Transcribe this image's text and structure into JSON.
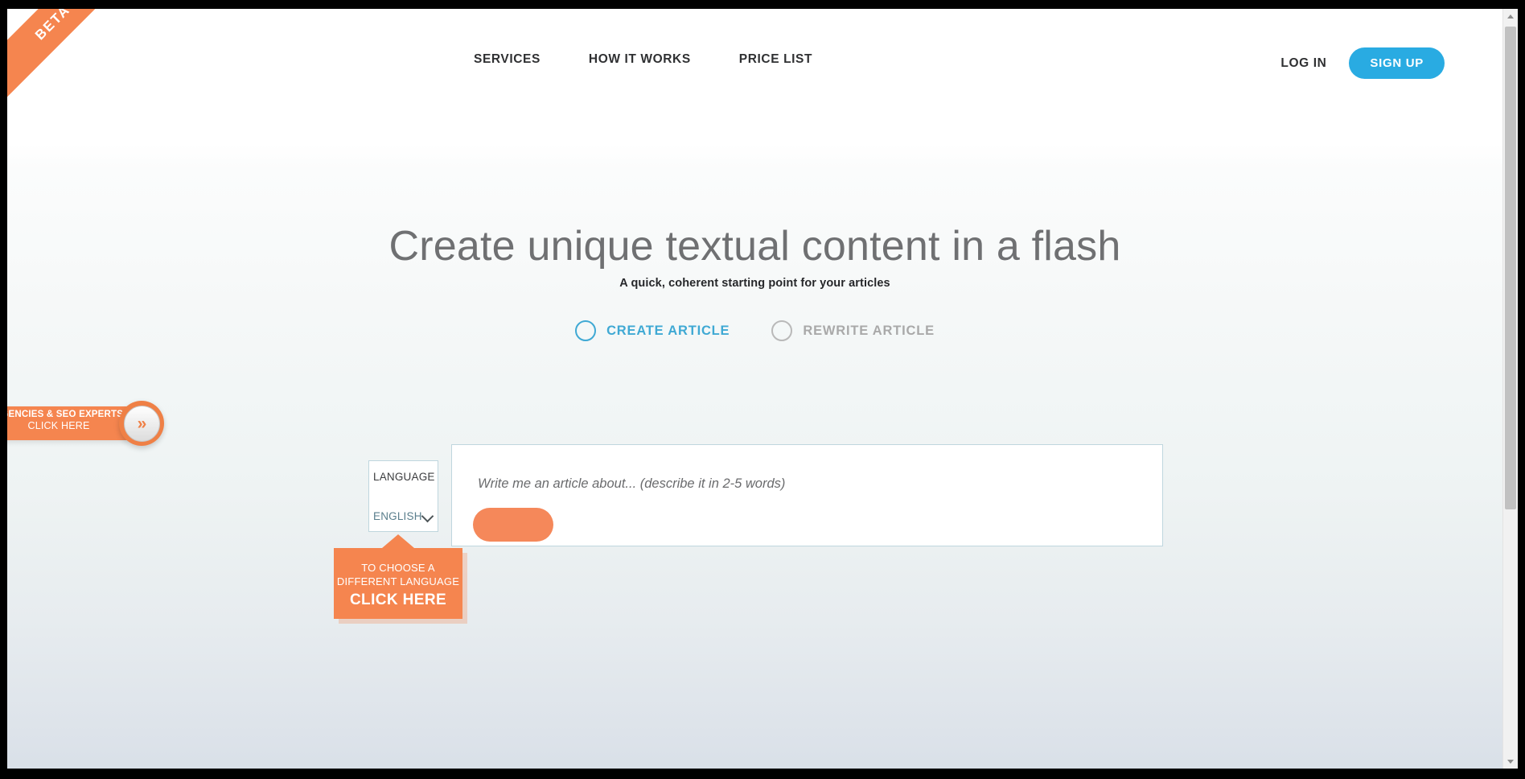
{
  "header": {
    "beta_badge": "BETA",
    "nav": [
      {
        "label": "SERVICES"
      },
      {
        "label": "HOW IT WORKS"
      },
      {
        "label": "PRICE LIST"
      }
    ],
    "login_label": "LOG IN",
    "signup_label": "SIGN UP",
    "accent_blue": "#29abe2"
  },
  "hero": {
    "title": "Create unique textual content in a flash",
    "subtitle": "A quick, coherent starting point for your articles"
  },
  "modes": {
    "items": [
      {
        "label": "CREATE ARTICLE",
        "selected": true
      },
      {
        "label": "REWRITE ARTICLE",
        "selected": false
      }
    ],
    "selected_color": "#3fa9d4",
    "unselected_color": "#a9a9a9"
  },
  "language": {
    "title": "LANGUAGE",
    "value": "ENGLISH",
    "chevron_icon": "chevron-down-icon"
  },
  "composer": {
    "placeholder": "Write me an article about... (describe it in 2-5 words)",
    "value": "",
    "generate_label": "",
    "button_color": "#f5885a"
  },
  "callouts": {
    "language": {
      "line1": "TO CHOOSE A",
      "line2": "DIFFERENT LANGUAGE",
      "action": "CLICK HERE",
      "color": "#f5854f"
    },
    "agencies": {
      "line1": "AGENCIES & SEO EXPERTS",
      "line2": "CLICK HERE",
      "badge_icon": "double-chevron-right-icon",
      "badge_glyph": "»",
      "color": "#f5854f"
    }
  },
  "scrollbar": {
    "up_icon": "scroll-up-arrow-icon",
    "down_icon": "scroll-down-arrow-icon",
    "thumb_name": "scrollbar-thumb"
  }
}
